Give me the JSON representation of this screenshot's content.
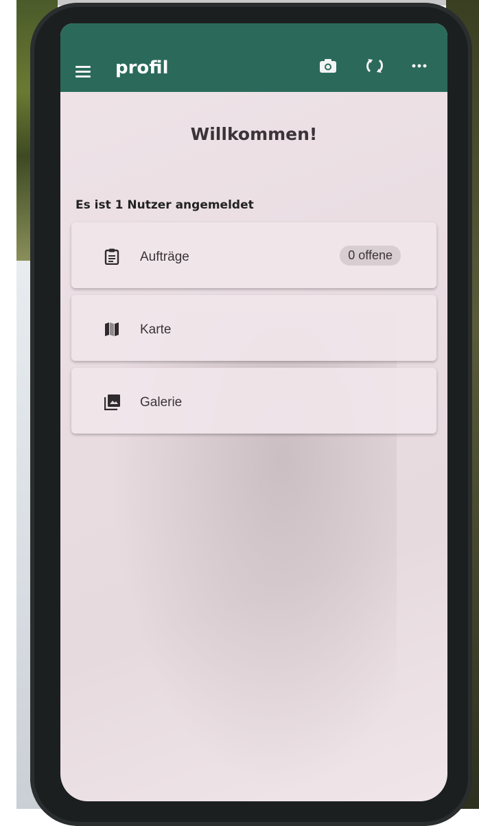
{
  "appbar": {
    "title": "profil",
    "color": "#2b6a5b",
    "icons": [
      "menu-icon",
      "camera-icon",
      "sync-icon",
      "more-icon"
    ]
  },
  "main": {
    "welcome": "Willkommen!",
    "users_status": "Es ist 1 Nutzer angemeldet"
  },
  "cards": [
    {
      "icon": "clipboard-icon",
      "label": "Aufträge",
      "badge": "0 offene"
    },
    {
      "icon": "map-icon",
      "label": "Karte"
    },
    {
      "icon": "gallery-icon",
      "label": "Galerie"
    }
  ]
}
